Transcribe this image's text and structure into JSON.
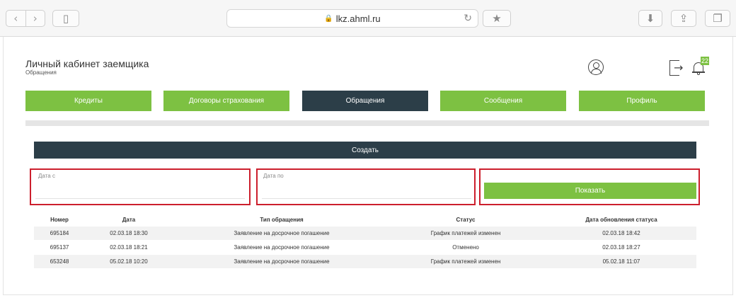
{
  "browser": {
    "url": "lkz.ahml.ru",
    "back_icon": "chevron-left-icon",
    "forward_icon": "chevron-right-icon",
    "sidebar_icon": "sidebar-icon",
    "reload_icon": "reload-icon",
    "bookmark_icon": "star-icon",
    "download_icon": "download-icon",
    "share_icon": "share-icon",
    "tabs_icon": "tabs-icon"
  },
  "header": {
    "title": "Личный кабинет заемщика",
    "subtitle": "Обращения",
    "notifications_count": "22"
  },
  "tabs": [
    {
      "label": "Кредиты",
      "active": false
    },
    {
      "label": "Договоры страхования",
      "active": false
    },
    {
      "label": "Обращения",
      "active": true
    },
    {
      "label": "Сообщения",
      "active": false
    },
    {
      "label": "Профиль",
      "active": false
    }
  ],
  "actions": {
    "create_label": "Создать",
    "show_label": "Показать"
  },
  "filters": {
    "date_from_label": "Дата с",
    "date_from_value": "",
    "date_to_label": "Дата по",
    "date_to_value": ""
  },
  "table": {
    "headers": [
      "Номер",
      "Дата",
      "Тип обращения",
      "Статус",
      "Дата обновления статуса"
    ],
    "rows": [
      [
        "695184",
        "02.03.18 18:30",
        "Заявление на досрочное погашение",
        "График платежей изменен",
        "02.03.18 18:42"
      ],
      [
        "695137",
        "02.03.18 18:21",
        "Заявление на досрочное погашение",
        "Отменено",
        "02.03.18 18:27"
      ],
      [
        "653248",
        "05.02.18 10:20",
        "Заявление на досрочное погашение",
        "График платежей изменен",
        "05.02.18 11:07"
      ]
    ]
  },
  "colors": {
    "accent_green": "#7dc142",
    "dark_slate": "#2c3e48",
    "highlight_red": "#cc1f2d"
  }
}
